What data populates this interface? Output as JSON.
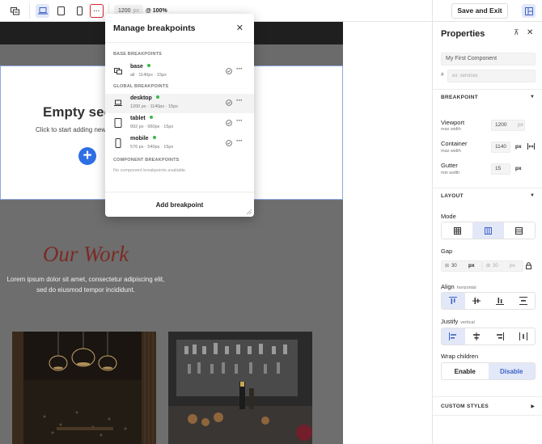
{
  "toolbar": {
    "viewport_value": "1200",
    "viewport_unit": "px",
    "zoom": "@ 100%",
    "more_label": "···"
  },
  "header": {
    "save_exit_label": "Save and Exit"
  },
  "canvas": {
    "empty_title": "Empty sec",
    "empty_subtitle": "Click to start adding new",
    "plus_label": "+",
    "work_title": "Our Work",
    "work_text_1": "Lorem ipsum dolor sit amet, consectetur adipiscing elit,",
    "work_text_2": "sed do eiusmod tempor incididunt."
  },
  "modal": {
    "title": "Manage breakpoints",
    "close_label": "✕",
    "base_section": "BASE BREAKPOINTS",
    "global_section": "GLOBAL BREAKPOINTS",
    "component_section": "COMPONENT BREAKPOINTS",
    "component_empty": "No component breakpoints available.",
    "add_label": "Add breakpoint",
    "more_label": "···",
    "base": {
      "name": "base",
      "meta": "all · 1140px · 15px"
    },
    "global": [
      {
        "name": "desktop",
        "meta": "1200 px · 1140px · 15px",
        "icon": "laptop-icon"
      },
      {
        "name": "tablet",
        "meta": "992 px · 960px · 15px",
        "icon": "tablet-icon"
      },
      {
        "name": "mobile",
        "meta": "576 px · 540px · 15px",
        "icon": "mobile-icon"
      }
    ]
  },
  "properties": {
    "title": "Properties",
    "pin_label": "⊼",
    "close_label": "✕",
    "component_name": "My First Component",
    "hash": "#",
    "class_placeholder": "ex: services",
    "breakpoint_section": "BREAKPOINT",
    "viewport_label": "Viewport",
    "viewport_sub": "max width",
    "viewport_value": "1200",
    "viewport_unit": "px",
    "container_label": "Container",
    "container_sub": "max width",
    "container_value": "1140",
    "container_unit": "px",
    "gutter_label": "Gutter",
    "gutter_sub": "min width",
    "gutter_value": "15",
    "gutter_unit": "px",
    "layout_section": "LAYOUT",
    "mode_label": "Mode",
    "gap_label": "Gap",
    "gap_col_value": "30",
    "gap_col_unit": "px",
    "gap_row_value": "30",
    "gap_row_unit": "px",
    "align_label": "Align",
    "align_sub": "horizontal",
    "justify_label": "Justify",
    "justify_sub": "vertical",
    "wrap_label": "Wrap children",
    "wrap_enable": "Enable",
    "wrap_disable": "Disable",
    "custom_styles_section": "CUSTOM STYLES"
  },
  "colors": {
    "accent": "#3d63c9",
    "active_bg": "#e3e8f8",
    "status_green": "#3cb84a",
    "title_red": "#7a2b24"
  }
}
